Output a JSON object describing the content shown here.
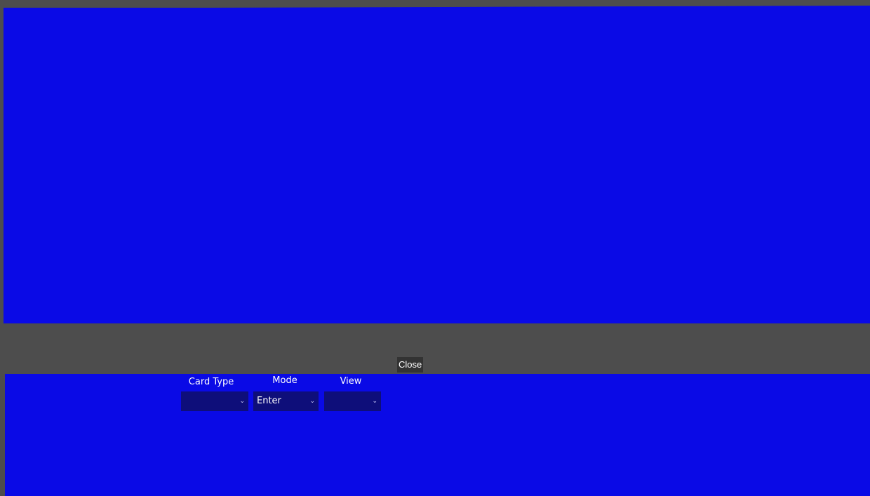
{
  "controls": {
    "close_label": "Close",
    "card_type": {
      "label": "Card Type",
      "value": ""
    },
    "mode": {
      "label": "Mode",
      "value": "Enter"
    },
    "view": {
      "label": "View",
      "value": ""
    }
  },
  "icons": {
    "dropdown": "chevron-down-icon"
  },
  "colors": {
    "panel_blue": "#0a0ae6",
    "select_bg": "#0e0e7a",
    "divider_gray": "#4d4d4d"
  }
}
